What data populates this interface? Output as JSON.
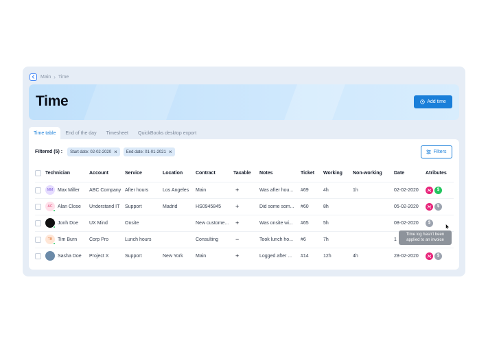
{
  "breadcrumb": {
    "items": [
      "Main",
      "Time"
    ]
  },
  "header": {
    "title": "Time",
    "add_label": "Add time"
  },
  "tabs": [
    {
      "label": "Time table",
      "active": true
    },
    {
      "label": "End of the day",
      "active": false
    },
    {
      "label": "Timesheet",
      "active": false
    },
    {
      "label": "QuickBooks desktop export",
      "active": false
    }
  ],
  "filters": {
    "label": "Filtered (5) :",
    "chips": [
      "Start date: 02-02-2020",
      "End date: 01-01-2021"
    ],
    "button_label": "Filters"
  },
  "table": {
    "columns": [
      "Technician",
      "Account",
      "Service",
      "Location",
      "Contract",
      "Taxable",
      "Notes",
      "Ticket",
      "Working",
      "Non-working",
      "Date",
      "Atributes"
    ],
    "rows": [
      {
        "initials": "MM",
        "avatar_bg": "#e5dcff",
        "avatar_fg": "#7c5cd6",
        "online": false,
        "technician": "Max Miller",
        "account": "ABC Company",
        "service": "After hours",
        "location": "Los Angeles",
        "contract": "Main",
        "taxable": "+",
        "notes": "Was after hou...",
        "ticket": "#69",
        "working": "4h",
        "non_working": "1h",
        "date": "02-02-2020",
        "attributes": [
          "pink",
          "green"
        ]
      },
      {
        "initials": "AC",
        "avatar_bg": "#ffe0ea",
        "avatar_fg": "#e04a7a",
        "online": true,
        "technician": "Alan Close",
        "account": "Understand IT",
        "service": "Support",
        "location": "Madrid",
        "contract": "HS0945845",
        "taxable": "+",
        "notes": "Did some som...",
        "ticket": "#60",
        "working": "8h",
        "non_working": "",
        "date": "05-02-2020",
        "attributes": [
          "pink",
          "gray"
        ]
      },
      {
        "initials": "",
        "avatar_bg": "#111111",
        "avatar_fg": "#ffffff",
        "online": true,
        "technician": "Jonh Doe",
        "account": "UX Mind",
        "service": "Onsite",
        "location": "",
        "contract": "New custome...",
        "taxable": "+",
        "notes": "Was onsite wi...",
        "ticket": "#65",
        "working": "5h",
        "non_working": "",
        "date": "08-02-2020",
        "attributes": [
          "gray"
        ]
      },
      {
        "initials": "TB",
        "avatar_bg": "#ffe6d6",
        "avatar_fg": "#e07a3c",
        "online": true,
        "technician": "Tim Burn",
        "account": "Corp Pro",
        "service": "Lunch hours",
        "location": "",
        "contract": "Consulting",
        "taxable": "−",
        "notes": "Took lunch ho...",
        "ticket": "#6",
        "working": "7h",
        "non_working": "",
        "date": "1",
        "attributes": []
      },
      {
        "initials": "",
        "avatar_bg": "#6b8aa8",
        "avatar_fg": "#ffffff",
        "online": false,
        "technician": "Sasha Doe",
        "account": "Project X",
        "service": "Support",
        "location": "New York",
        "contract": "Main",
        "taxable": "+",
        "notes": "Logged after ...",
        "ticket": "#14",
        "working": "12h",
        "non_working": "4h",
        "date": "28-02-2020",
        "attributes": [
          "pink",
          "gray"
        ]
      }
    ]
  },
  "tooltip": {
    "line1": "Time log hasn't been",
    "line2": "applied to an invoice"
  },
  "colors": {
    "accent": "#1a7fd9",
    "pink": "#e8247a",
    "green": "#22c55e",
    "gray": "#9ca3af"
  }
}
